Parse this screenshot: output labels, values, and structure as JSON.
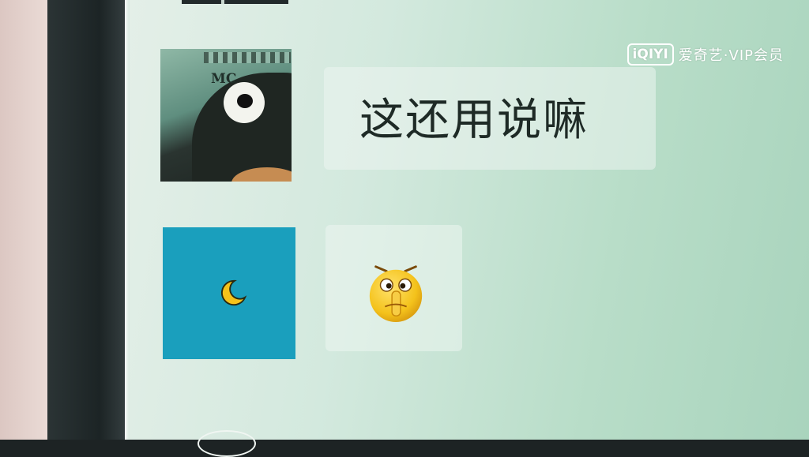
{
  "watermark": {
    "logo_text": "iQIYI",
    "label": "爱奇艺·VIP会员"
  },
  "chat": {
    "messages": [
      {
        "type": "text",
        "text": "这还用说嘛",
        "avatar_icon": "penguin-avatar-icon",
        "avatar_text": "MC"
      },
      {
        "type": "emoji",
        "emoji_icon": "shush-emoji-icon",
        "avatar_icon": "crescent-moon-avatar-icon"
      }
    ]
  },
  "colors": {
    "screen_bg": "#cfe6da",
    "avatar2_bg": "#1a9fbd",
    "emoji_yellow": "#f4c21b"
  }
}
